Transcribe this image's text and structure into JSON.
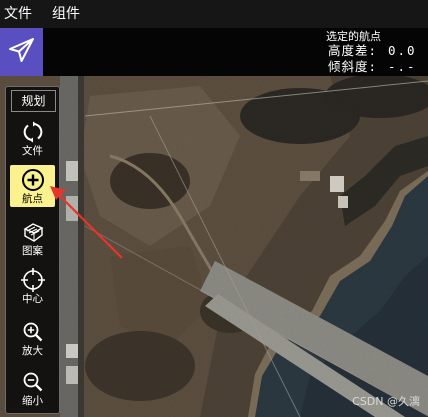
{
  "menu": {
    "items": [
      "文件",
      "组件"
    ]
  },
  "telemetry": {
    "title": "选定的航点",
    "rows": [
      {
        "label": "高度差:",
        "value": "0.0"
      },
      {
        "label": "倾斜度:",
        "value": "-.-"
      }
    ]
  },
  "toolbar": {
    "title": "规划",
    "buttons": [
      {
        "label": "文件",
        "icon": "refresh-icon"
      },
      {
        "label": "航点",
        "icon": "add-circle-icon",
        "active": true
      },
      {
        "label": "图案",
        "icon": "pattern-icon"
      },
      {
        "label": "中心",
        "icon": "crosshair-icon"
      },
      {
        "label": "放大",
        "icon": "zoom-in-icon"
      },
      {
        "label": "缩小",
        "icon": "zoom-out-icon"
      }
    ]
  },
  "watermark": "CSDN @久漓",
  "colors": {
    "logo_bg": "#5a4fc0",
    "active_btn": "#fbf28f",
    "arrow": "#e8342a"
  }
}
